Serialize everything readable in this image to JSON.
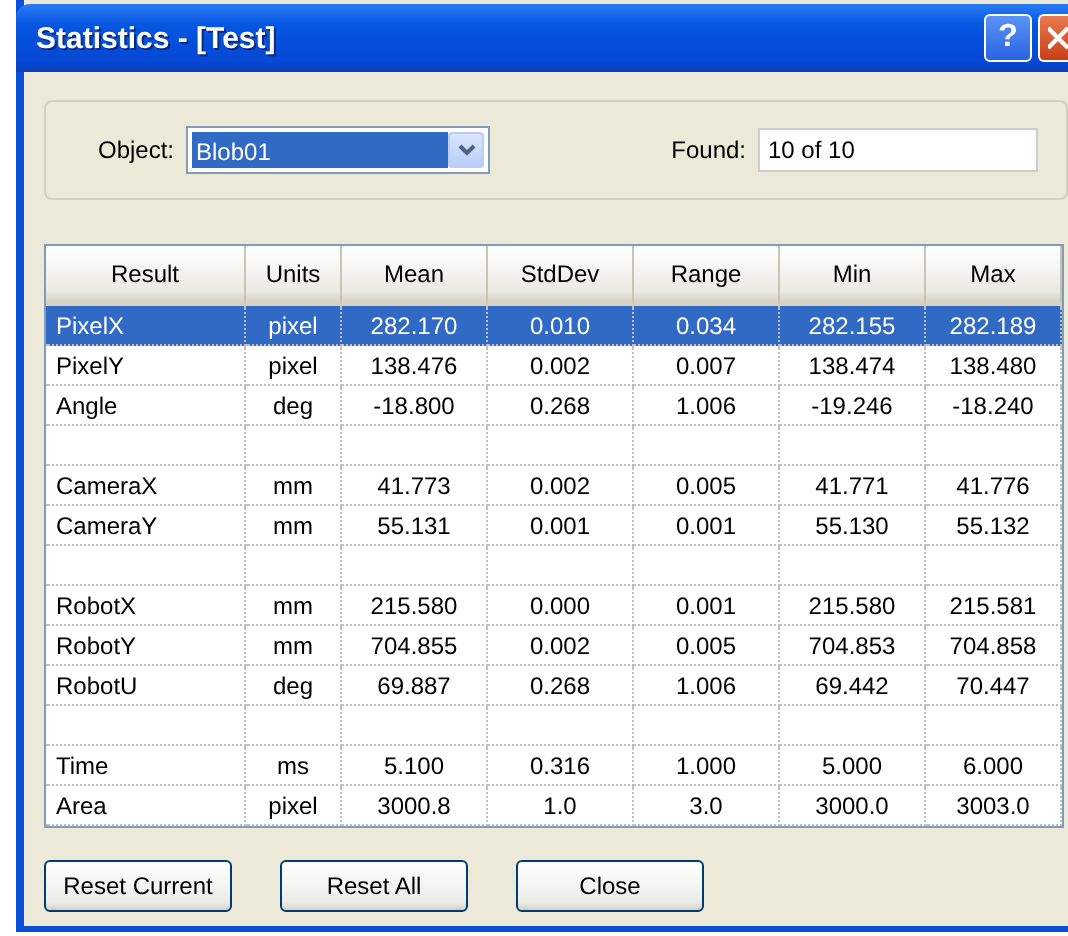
{
  "window": {
    "title": "Statistics - [Test]",
    "help_button": "?"
  },
  "object_field": {
    "label": "Object:",
    "value": "Blob01"
  },
  "found_field": {
    "label": "Found:",
    "value": "10 of 10"
  },
  "table": {
    "columns": [
      "Result",
      "Units",
      "Mean",
      "StdDev",
      "Range",
      "Min",
      "Max"
    ],
    "rows": [
      {
        "kind": "data",
        "selected": true,
        "cells": [
          "PixelX",
          "pixel",
          "282.170",
          "0.010",
          "0.034",
          "282.155",
          "282.189"
        ]
      },
      {
        "kind": "data",
        "selected": false,
        "cells": [
          "PixelY",
          "pixel",
          "138.476",
          "0.002",
          "0.007",
          "138.474",
          "138.480"
        ]
      },
      {
        "kind": "data",
        "selected": false,
        "cells": [
          "Angle",
          "deg",
          "-18.800",
          "0.268",
          "1.006",
          "-19.246",
          "-18.240"
        ]
      },
      {
        "kind": "blank",
        "selected": false
      },
      {
        "kind": "data",
        "selected": false,
        "cells": [
          "CameraX",
          "mm",
          "41.773",
          "0.002",
          "0.005",
          "41.771",
          "41.776"
        ]
      },
      {
        "kind": "data",
        "selected": false,
        "cells": [
          "CameraY",
          "mm",
          "55.131",
          "0.001",
          "0.001",
          "55.130",
          "55.132"
        ]
      },
      {
        "kind": "blank",
        "selected": false
      },
      {
        "kind": "data",
        "selected": false,
        "cells": [
          "RobotX",
          "mm",
          "215.580",
          "0.000",
          "0.001",
          "215.580",
          "215.581"
        ]
      },
      {
        "kind": "data",
        "selected": false,
        "cells": [
          "RobotY",
          "mm",
          "704.855",
          "0.002",
          "0.005",
          "704.853",
          "704.858"
        ]
      },
      {
        "kind": "data",
        "selected": false,
        "cells": [
          "RobotU",
          "deg",
          "69.887",
          "0.268",
          "1.006",
          "69.442",
          "70.447"
        ]
      },
      {
        "kind": "blank",
        "selected": false
      },
      {
        "kind": "data",
        "selected": false,
        "cells": [
          "Time",
          "ms",
          "5.100",
          "0.316",
          "1.000",
          "5.000",
          "6.000"
        ]
      },
      {
        "kind": "data",
        "selected": false,
        "cells": [
          "Area",
          "pixel",
          "3000.8",
          "1.0",
          "3.0",
          "3000.0",
          "3003.0"
        ]
      }
    ]
  },
  "buttons": [
    "Reset Current",
    "Reset All",
    "Close"
  ]
}
